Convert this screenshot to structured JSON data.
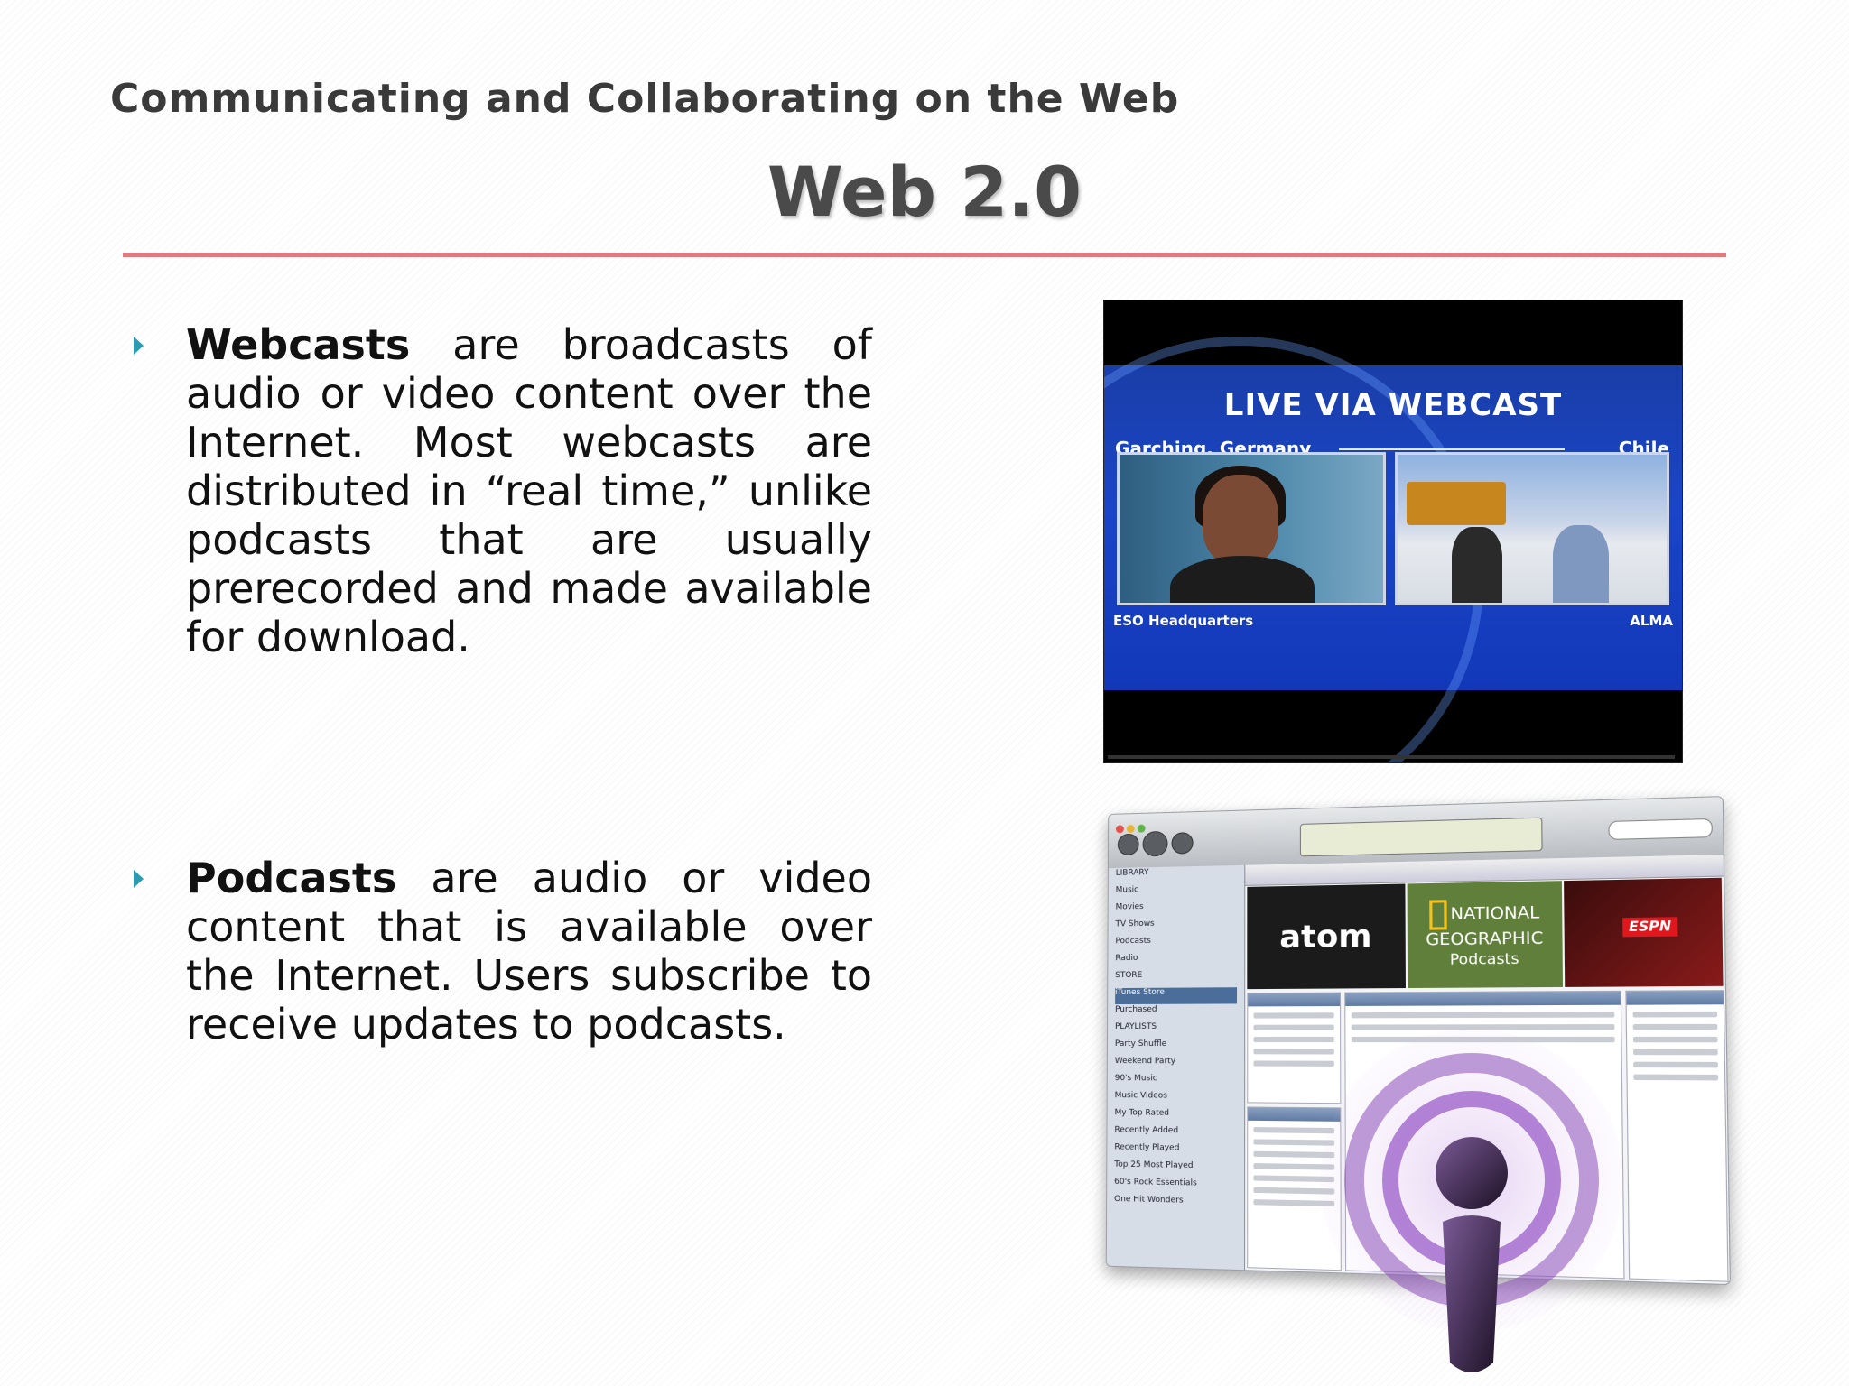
{
  "header": {
    "deck_title": "Communicating and Collaborating on the Web",
    "slide_title": "Web 2.0"
  },
  "bullets": [
    {
      "term": "Webcasts",
      "text": " are broadcasts of audio or video content over the Internet. Most webcasts are distributed in “real time,” unlike podcasts that are usually prerecorded and made available for download."
    },
    {
      "term": "Podcasts",
      "text": " are audio or video content that is available over the Internet. Users subscribe to receive updates to podcasts."
    }
  ],
  "webcast_image": {
    "headline": "LIVE VIA WEBCAST",
    "left_location": "Garching, Germany",
    "right_location": "Chile",
    "left_caption": "ESO Headquarters",
    "right_caption": "ALMA"
  },
  "itunes_image": {
    "banner_atom": "atom",
    "banner_ng_line1": "NATIONAL",
    "banner_ng_line2": "GEOGRAPHIC",
    "banner_ng_line3": "Podcasts",
    "banner_espn": "ESPN",
    "sidebar": [
      "LIBRARY",
      "Music",
      "Movies",
      "TV Shows",
      "Podcasts",
      "Radio",
      "STORE",
      "iTunes Store",
      "Purchased",
      "PLAYLISTS",
      "Party Shuffle",
      "Weekend Party",
      "90's Music",
      "Music Videos",
      "My Top Rated",
      "Recently Added",
      "Recently Played",
      "Top 25 Most Played",
      "60's Rock Essentials",
      "One Hit Wonders"
    ]
  },
  "colors": {
    "rule": "#e07a80",
    "bullet_marker": "#2a9bb0",
    "webcast_blue": "#1a45c8",
    "podcast_purple": "#6a3a8a"
  }
}
